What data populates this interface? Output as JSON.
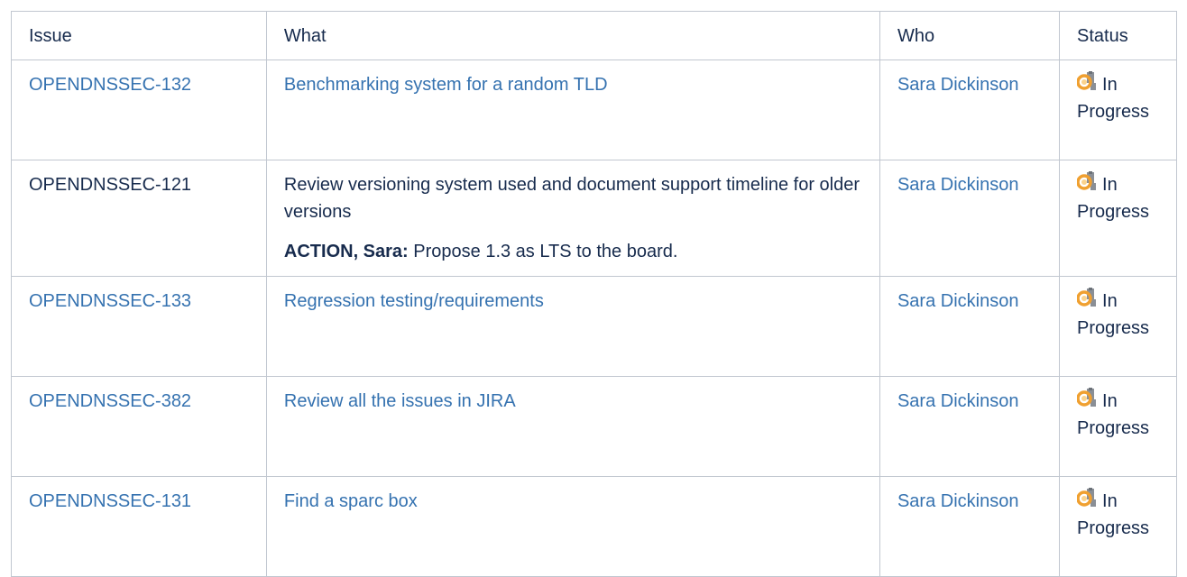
{
  "headers": {
    "issue": "Issue",
    "what": "What",
    "who": "Who",
    "status": "Status"
  },
  "rows": [
    {
      "issue": "OPENDNSSEC-132",
      "what": "Benchmarking system for a random TLD",
      "who": "Sara Dickinson",
      "status": "In Progress"
    },
    {
      "issue": "OPENDNSSEC-121",
      "what": "Review versioning system used and document support timeline for older versions",
      "action_label": "ACTION, Sara:",
      "action_text": " Propose 1.3 as LTS to the board.",
      "who": "Sara Dickinson",
      "status": "In Progress"
    },
    {
      "issue": "OPENDNSSEC-133",
      "what": "Regression testing/requirements",
      "who": "Sara Dickinson",
      "status": "In Progress"
    },
    {
      "issue": "OPENDNSSEC-382",
      "what": "Review all the issues in JIRA",
      "who": "Sara Dickinson",
      "status": "In Progress"
    },
    {
      "issue": "OPENDNSSEC-131",
      "what": "Find a sparc box",
      "who": "Sara Dickinson",
      "status": "In Progress"
    }
  ],
  "icons": {
    "status": "in-progress-icon"
  },
  "colors": {
    "link": "#3572b0",
    "text": "#172b4d",
    "border": "#c1c7d0",
    "status_icon_orange": "#f0a030",
    "status_icon_gray": "#8a8f96"
  }
}
